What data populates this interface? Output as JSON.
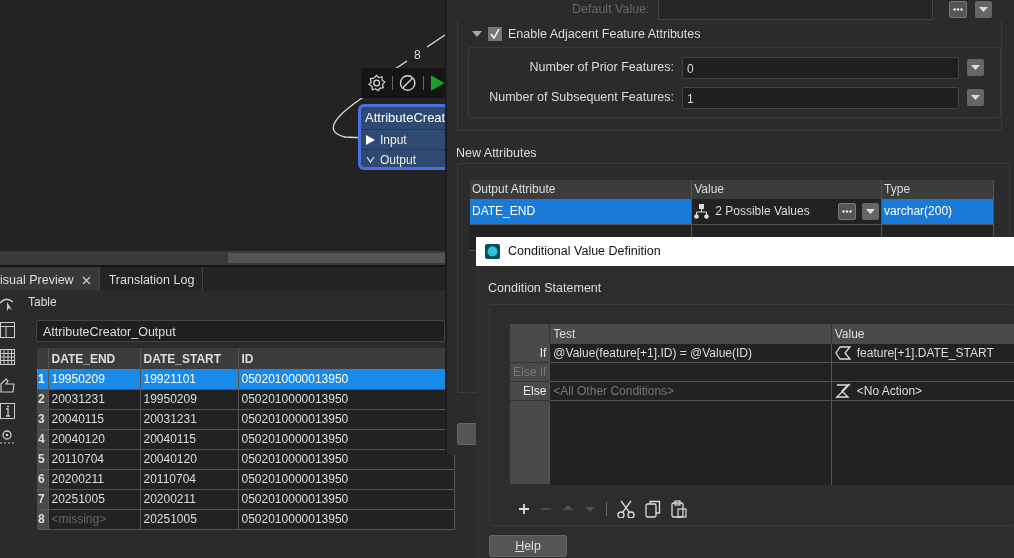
{
  "canvas": {
    "connection_label": "8",
    "node": {
      "title": "AttributeCreat",
      "ports": [
        {
          "kind": "input",
          "label": "Input"
        },
        {
          "kind": "output",
          "label": "Output"
        }
      ]
    }
  },
  "preview": {
    "tabs": [
      {
        "label": "isual Preview",
        "selected": true,
        "closable": true
      },
      {
        "label": "Translation Log",
        "selected": false,
        "closable": false
      }
    ],
    "section_label": "Table",
    "table_selector": "AttributeCreator_Output",
    "columns": [
      "DATE_END",
      "DATE_START",
      "ID"
    ],
    "rows": [
      {
        "number": "1",
        "selected": true,
        "missing": false,
        "cells": [
          "19950209",
          "19921101",
          "0502010000013950"
        ]
      },
      {
        "number": "2",
        "selected": false,
        "missing": false,
        "cells": [
          "20031231",
          "19950209",
          "0502010000013950"
        ]
      },
      {
        "number": "3",
        "selected": false,
        "missing": false,
        "cells": [
          "20040115",
          "20031231",
          "0502010000013950"
        ]
      },
      {
        "number": "4",
        "selected": false,
        "missing": false,
        "cells": [
          "20040120",
          "20040115",
          "0502010000013950"
        ]
      },
      {
        "number": "5",
        "selected": false,
        "missing": false,
        "cells": [
          "20110704",
          "20040120",
          "0502010000013950"
        ]
      },
      {
        "number": "6",
        "selected": false,
        "missing": false,
        "cells": [
          "20200211",
          "20110704",
          "0502010000013950"
        ]
      },
      {
        "number": "7",
        "selected": false,
        "missing": false,
        "cells": [
          "20251005",
          "20200211",
          "0502010000013950"
        ]
      },
      {
        "number": "8",
        "selected": false,
        "missing": true,
        "cells": [
          "<missing>",
          "20251005",
          "0502010000013950"
        ]
      }
    ]
  },
  "params": {
    "default_value_label": "Default Value:",
    "adjacent": {
      "label": "Enable Adjacent Feature Attributes",
      "checked": true,
      "expanded": true,
      "fields": [
        {
          "label": "Number of Prior Features:",
          "value": "0"
        },
        {
          "label": "Number of Subsequent Features:",
          "value": "1"
        }
      ]
    },
    "new_attributes": {
      "title": "New Attributes",
      "columns": [
        "Output Attribute",
        "Value",
        "Type"
      ],
      "rows": [
        {
          "output_attribute": "DATE_END",
          "value": "2 Possible Values",
          "type": "varchar(200)",
          "selected": true
        }
      ]
    }
  },
  "conditional_dialog": {
    "title": "Conditional Value Definition",
    "group_label": "Condition Statement",
    "columns": [
      "Test",
      "Value"
    ],
    "rows": [
      {
        "kind": "if",
        "label": "If",
        "disabled": false,
        "test": "@Value(feature[+1].ID) = @Value(ID)",
        "value": "feature[+1].DATE_START"
      },
      {
        "kind": "elseif",
        "label": "Else If",
        "disabled": true
      },
      {
        "kind": "else",
        "label": "Else",
        "disabled": false,
        "test_placeholder": "<All Other Conditions>",
        "value": "<No Action>"
      }
    ],
    "toolbar": [
      {
        "kind": "add",
        "disabled": false
      },
      {
        "kind": "remove",
        "disabled": true
      },
      {
        "kind": "up",
        "disabled": true
      },
      {
        "kind": "down",
        "disabled": true
      },
      {
        "kind": "separator"
      },
      {
        "kind": "cut",
        "disabled": false
      },
      {
        "kind": "copy",
        "disabled": false
      },
      {
        "kind": "paste",
        "disabled": false
      }
    ],
    "help_button": "Help"
  }
}
